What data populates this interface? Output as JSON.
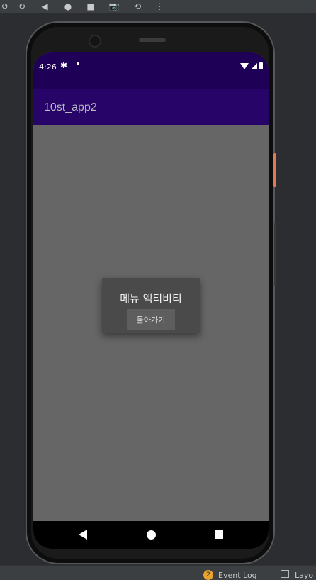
{
  "ide": {
    "toolbar_icons": [
      "rotate-left-icon",
      "rotate-right-icon",
      "back-icon",
      "home-icon",
      "overview-icon",
      "camera-icon",
      "snapshot-icon",
      "more-icon"
    ],
    "bottom": {
      "event_count": "2",
      "event_log_label": "Event Log",
      "layout_label": "Layo"
    }
  },
  "device": {
    "status_time": "4:26",
    "app_title": "10st_app2",
    "dialog": {
      "title": "메뉴 액티비티",
      "button_label": "돌아가기"
    },
    "colors": {
      "status_bar": "#1e0057",
      "app_bar": "#270468",
      "screen_bg": "#666666",
      "dialog_bg": "#4a4a4a"
    }
  }
}
